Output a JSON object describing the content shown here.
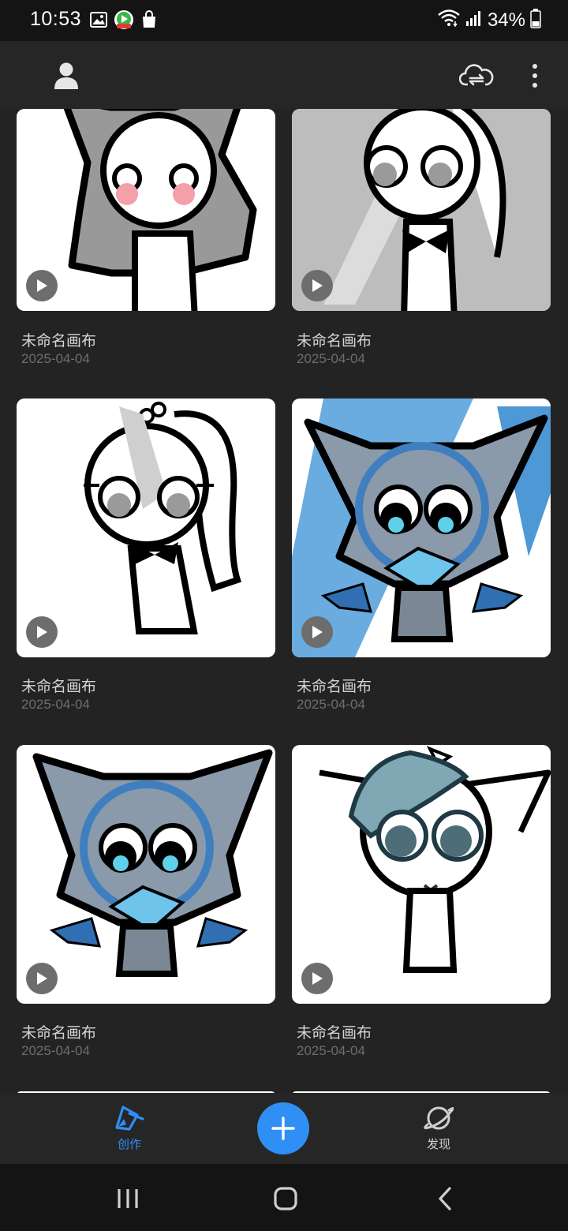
{
  "status_bar": {
    "time": "10:53",
    "battery": "34%",
    "left_icons": [
      "gallery-icon",
      "app-icon",
      "shopping-bag-icon"
    ],
    "right_icons": [
      "wifi-icon",
      "signal-icon",
      "battery-icon"
    ]
  },
  "app_bar": {
    "icons": [
      "profile-icon",
      "cloud-sync-icon",
      "more-vert-icon"
    ]
  },
  "canvases": [
    {
      "title": "未命名画布",
      "date": "2025-04-04"
    },
    {
      "title": "未命名画布",
      "date": "2025-04-04"
    },
    {
      "title": "未命名画布",
      "date": "2025-04-04"
    },
    {
      "title": "未命名画布",
      "date": "2025-04-04"
    },
    {
      "title": "未命名画布",
      "date": "2025-04-04"
    },
    {
      "title": "未命名画布",
      "date": "2025-04-04"
    }
  ],
  "bottom_nav": {
    "create_label": "创作",
    "discover_label": "发现",
    "fab_icon": "plus-icon"
  },
  "colors": {
    "accent": "#2f8ff5",
    "background": "#232323",
    "card": "#ffffff"
  }
}
